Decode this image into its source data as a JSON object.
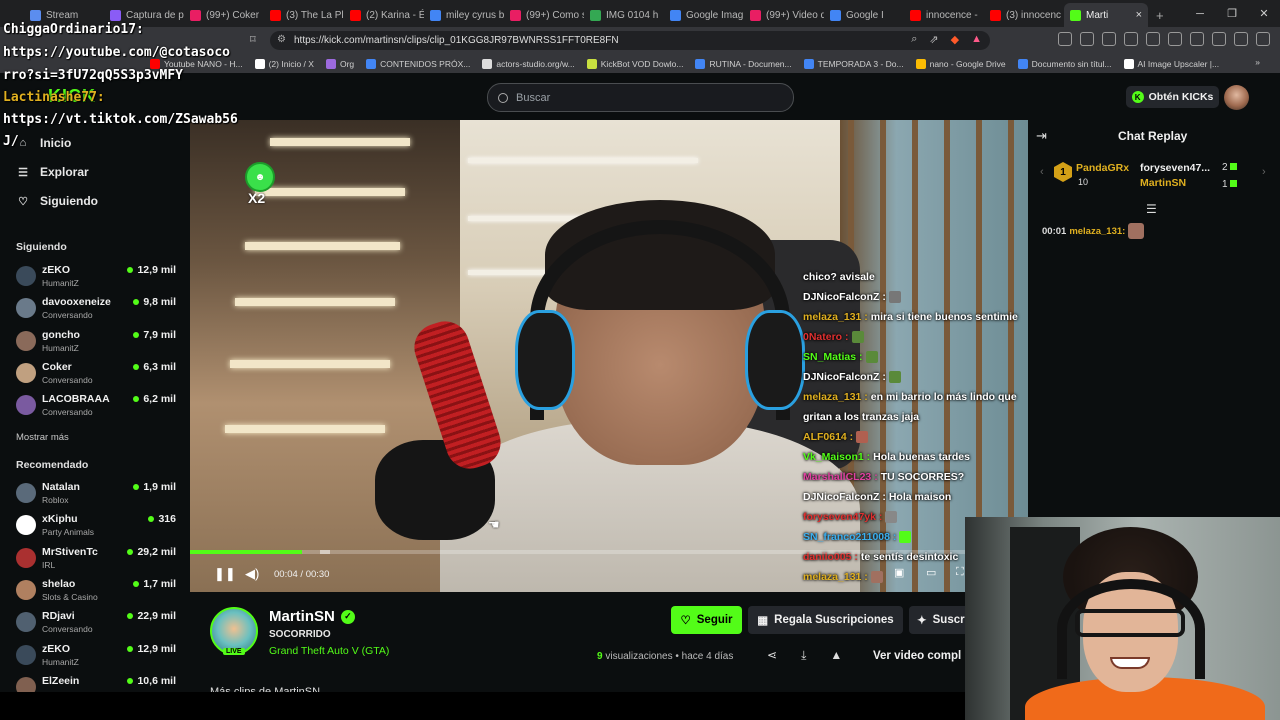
{
  "browser": {
    "tabs": [
      {
        "label": "Stream",
        "color": "#5b8def"
      },
      {
        "label": "Captura de p",
        "color": "#8a5cf6"
      },
      {
        "label": "(99+) Coker",
        "color": "#e91e63"
      },
      {
        "label": "(3) The La Pl",
        "color": "#ff0000"
      },
      {
        "label": "(2) Karina - É",
        "color": "#ff0000"
      },
      {
        "label": "miley cyrus b",
        "color": "#4285f4"
      },
      {
        "label": "(99+) Como s",
        "color": "#e91e63"
      },
      {
        "label": "IMG 0104 h",
        "color": "#34a853"
      },
      {
        "label": "Google Imag",
        "color": "#4285f4"
      },
      {
        "label": "(99+) Video d",
        "color": "#e91e63"
      },
      {
        "label": "Google I",
        "color": "#4285f4"
      },
      {
        "label": "innocence -",
        "color": "#ff0000"
      },
      {
        "label": "(3) innocenc",
        "color": "#ff0000"
      },
      {
        "label": "Marti",
        "color": "#53fc18"
      }
    ],
    "active_tab_close": "×",
    "new_tab": "+",
    "url": "https://kick.com/martinsn/clips/clip_01KGG8JR97BWNRSS1FFT0RE8FN",
    "bookmarks": [
      {
        "label": "Youtube NANO - H...",
        "color": "#ff0000"
      },
      {
        "label": "(2) Inicio / X",
        "color": "#ffffff"
      },
      {
        "label": "Org",
        "color": "#9c6ade"
      },
      {
        "label": "CONTENIDOS PRÓX...",
        "color": "#4285f4"
      },
      {
        "label": "actors-studio.org/w...",
        "color": "#dddddd"
      },
      {
        "label": "KickBot VOD Dowlo...",
        "color": "#c8e040"
      },
      {
        "label": "RUTINA - Documen...",
        "color": "#4285f4"
      },
      {
        "label": "TEMPORADA 3 - Do...",
        "color": "#4285f4"
      },
      {
        "label": "nano - Google Drive",
        "color": "#fbbc04"
      },
      {
        "label": "Documento sin títul...",
        "color": "#4285f4"
      },
      {
        "label": "AI Image Upscaler |...",
        "color": "#ffffff"
      }
    ],
    "window_controls": [
      "─",
      "❐",
      "✕"
    ]
  },
  "overlay": {
    "line1": "ChiggaOrdinario17:",
    "line2": "https://youtube.com/@cotasoco",
    "line3": "rro?si=3fU72qQ5S3p3vMFY",
    "line4": "Lactinashe77:",
    "line5": "https://vt.tiktok.com/ZSawab56",
    "line6": "J/",
    "logo": "KICK"
  },
  "header": {
    "search_placeholder": "Buscar",
    "get_kicks": "Obtén KICKs"
  },
  "sidebar": {
    "nav": [
      {
        "label": "Inicio",
        "icon": "home-icon",
        "glyph": "⌂"
      },
      {
        "label": "Explorar",
        "icon": "explore-icon",
        "glyph": "☰"
      },
      {
        "label": "Siguiendo",
        "icon": "heart-icon",
        "glyph": "♡"
      }
    ],
    "following_title": "Siguiendo",
    "following": [
      {
        "name": "zEKO",
        "category": "HumanitZ",
        "viewers": "12,9 mil",
        "color": "#3a4a5a"
      },
      {
        "name": "davooxeneize",
        "category": "Conversando",
        "viewers": "9,8 mil",
        "color": "#6a7a8a"
      },
      {
        "name": "goncho",
        "category": "HumanitZ",
        "viewers": "7,9 mil",
        "color": "#8a6a5a"
      },
      {
        "name": "Coker",
        "category": "Conversando",
        "viewers": "6,3 mil",
        "color": "#c0a080"
      },
      {
        "name": "LACOBRAAA",
        "category": "Conversando",
        "viewers": "6,2 mil",
        "color": "#7a5aa0"
      }
    ],
    "show_more": "Mostrar más",
    "recommended_title": "Recomendado",
    "recommended": [
      {
        "name": "Natalan",
        "category": "Roblox",
        "viewers": "1,9 mil",
        "color": "#5a6a7a"
      },
      {
        "name": "xKiphu",
        "category": "Party Animals",
        "viewers": "316",
        "color": "#ffffff"
      },
      {
        "name": "MrStivenTc",
        "category": "IRL",
        "viewers": "29,2 mil",
        "color": "#aa3030"
      },
      {
        "name": "shelao",
        "category": "Slots & Casino",
        "viewers": "1,7 mil",
        "color": "#b08060"
      },
      {
        "name": "RDjavi",
        "category": "Conversando",
        "viewers": "22,9 mil",
        "color": "#506070"
      },
      {
        "name": "zEKO",
        "category": "HumanitZ",
        "viewers": "12,9 mil",
        "color": "#3a4a5a"
      },
      {
        "name": "ElZeein",
        "category": "",
        "viewers": "10,6 mil",
        "color": "#806050"
      }
    ]
  },
  "video": {
    "emote_label": "X2",
    "chat": [
      {
        "user": "",
        "text": "chico? avisale",
        "color": "#e0b020"
      },
      {
        "user": "DJNicoFalconZ :",
        "text": "",
        "color": "#ffffff",
        "emote": "#777777"
      },
      {
        "user": "melaza_131 :",
        "text": "mira si tiene buenos sentimie",
        "color": "#e0b020"
      },
      {
        "user": "0Natero :",
        "text": "",
        "color": "#e03030",
        "emote": "#5a8a3a"
      },
      {
        "user": "SN_Matias :",
        "text": "",
        "color": "#53fc18",
        "emote": "#5a8a3a"
      },
      {
        "user": "DJNicoFalconZ :",
        "text": "",
        "color": "#ffffff",
        "emote": "#5a8a3a"
      },
      {
        "user": "melaza_131 :",
        "text": "en mi barrio lo más lindo que",
        "color": "#e0b020"
      },
      {
        "user": "",
        "text": "gritan a los tranzas jaja",
        "color": "#ffffff"
      },
      {
        "user": "ALF0614 :",
        "text": "",
        "color": "#e0b020",
        "emote": "#b06050"
      },
      {
        "user": "Vk_Maison1 :",
        "text": "Hola buenas tardes",
        "color": "#53fc18"
      },
      {
        "user": "MarshallCL23 :",
        "text": "TU SOCORRES?",
        "color": "#e040a0"
      },
      {
        "user": "DJNicoFalconZ :",
        "text": "Hola maison",
        "color": "#ffffff"
      },
      {
        "user": "foryseven47yk :",
        "text": "",
        "color": "#e03030",
        "emote": "#888888"
      },
      {
        "user": "SN_franco211008 :",
        "text": "",
        "color": "#3ab0f0",
        "emote": "#53fc18"
      },
      {
        "user": "danilo005 :",
        "text": "te sentís desintoxic",
        "color": "#e03030"
      },
      {
        "user": "melaza_131 :",
        "text": "",
        "color": "#e0b020",
        "emote": "#a07060"
      }
    ],
    "progress_fraction": 0.1333,
    "time": "00:04 / 00:30"
  },
  "stream": {
    "name": "MartinSN",
    "live": "LIVE",
    "clip_title": "SOCORRIDO",
    "game": "Grand Theft Auto V (GTA)",
    "follow": "Seguir",
    "gift": "Regala Suscripciones",
    "subscribe": "Suscr",
    "views_count": "9",
    "views_text": " visualizaciones • hace 4 días",
    "full_video": "Ver video compl",
    "more_from": "Más clips de MartinSN"
  },
  "chat_replay": {
    "title": "Chat Replay",
    "leader_rank": "1",
    "leader_name": "PandaGRx",
    "leader_count": "10",
    "second_name": "foryseven47...",
    "second_count": "2",
    "third_name": "MartinSN",
    "third_count": "1",
    "message_time": "00:01",
    "message_user": "melaza_131:"
  }
}
